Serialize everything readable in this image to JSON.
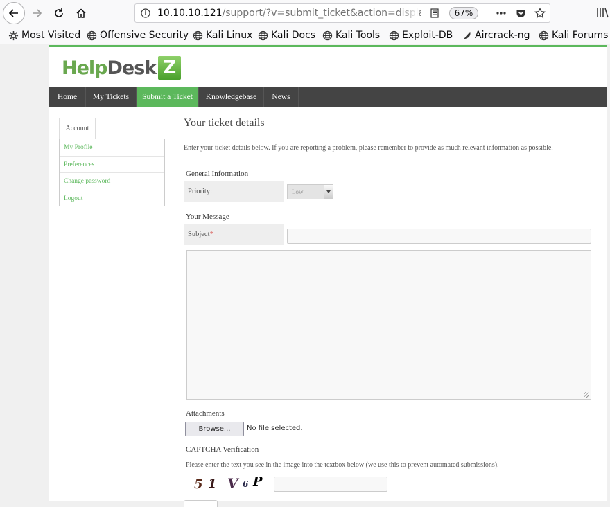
{
  "browser": {
    "url_host": "10.10.10.121",
    "url_path": "/support/?v=submit_ticket&action=displa",
    "zoom": "67%",
    "bookmarks": [
      {
        "label": "Most Visited",
        "icon": "gear-icon"
      },
      {
        "label": "Offensive Security",
        "icon": "globe-icon"
      },
      {
        "label": "Kali Linux",
        "icon": "globe-icon"
      },
      {
        "label": "Kali Docs",
        "icon": "globe-icon"
      },
      {
        "label": "Kali Tools",
        "icon": "globe-icon"
      },
      {
        "label": "Exploit-DB",
        "icon": "globe-icon"
      },
      {
        "label": "Aircrack-ng",
        "icon": "aircrack-icon"
      },
      {
        "label": "Kali Forums",
        "icon": "globe-icon"
      }
    ]
  },
  "site": {
    "logo": {
      "help": "Help",
      "desk": "Desk",
      "z": "Z"
    },
    "accent": "#5cb85c",
    "nav": [
      {
        "label": "Home",
        "active": false
      },
      {
        "label": "My Tickets",
        "active": false
      },
      {
        "label": "Submit a Ticket",
        "active": true
      },
      {
        "label": "Knowledgebase",
        "active": false
      },
      {
        "label": "News",
        "active": false
      }
    ]
  },
  "sidebar": {
    "tab": "Account",
    "links": [
      "My Profile",
      "Preferences",
      "Change password",
      "Logout"
    ]
  },
  "form": {
    "title": "Your ticket details",
    "intro": "Enter your ticket details below. If you are reporting a problem, please remember to provide as much relevant information as possible.",
    "general_heading": "General Information",
    "priority_label": "Priority:",
    "priority_value": "Low",
    "message_heading": "Your Message",
    "subject_label": "Subject",
    "required_mark": "*",
    "subject_value": "",
    "message_value": "",
    "attachments_heading": "Attachments",
    "browse_label": "Browse...",
    "no_file": "No file selected.",
    "captcha_heading": "CAPTCHA Verification",
    "captcha_text": "Please enter the text you see in the image into the textbox below (we use this to prevent automated submissions).",
    "captcha_chars": [
      "5",
      "1",
      "V",
      "6",
      "P"
    ],
    "captcha_value": ""
  }
}
